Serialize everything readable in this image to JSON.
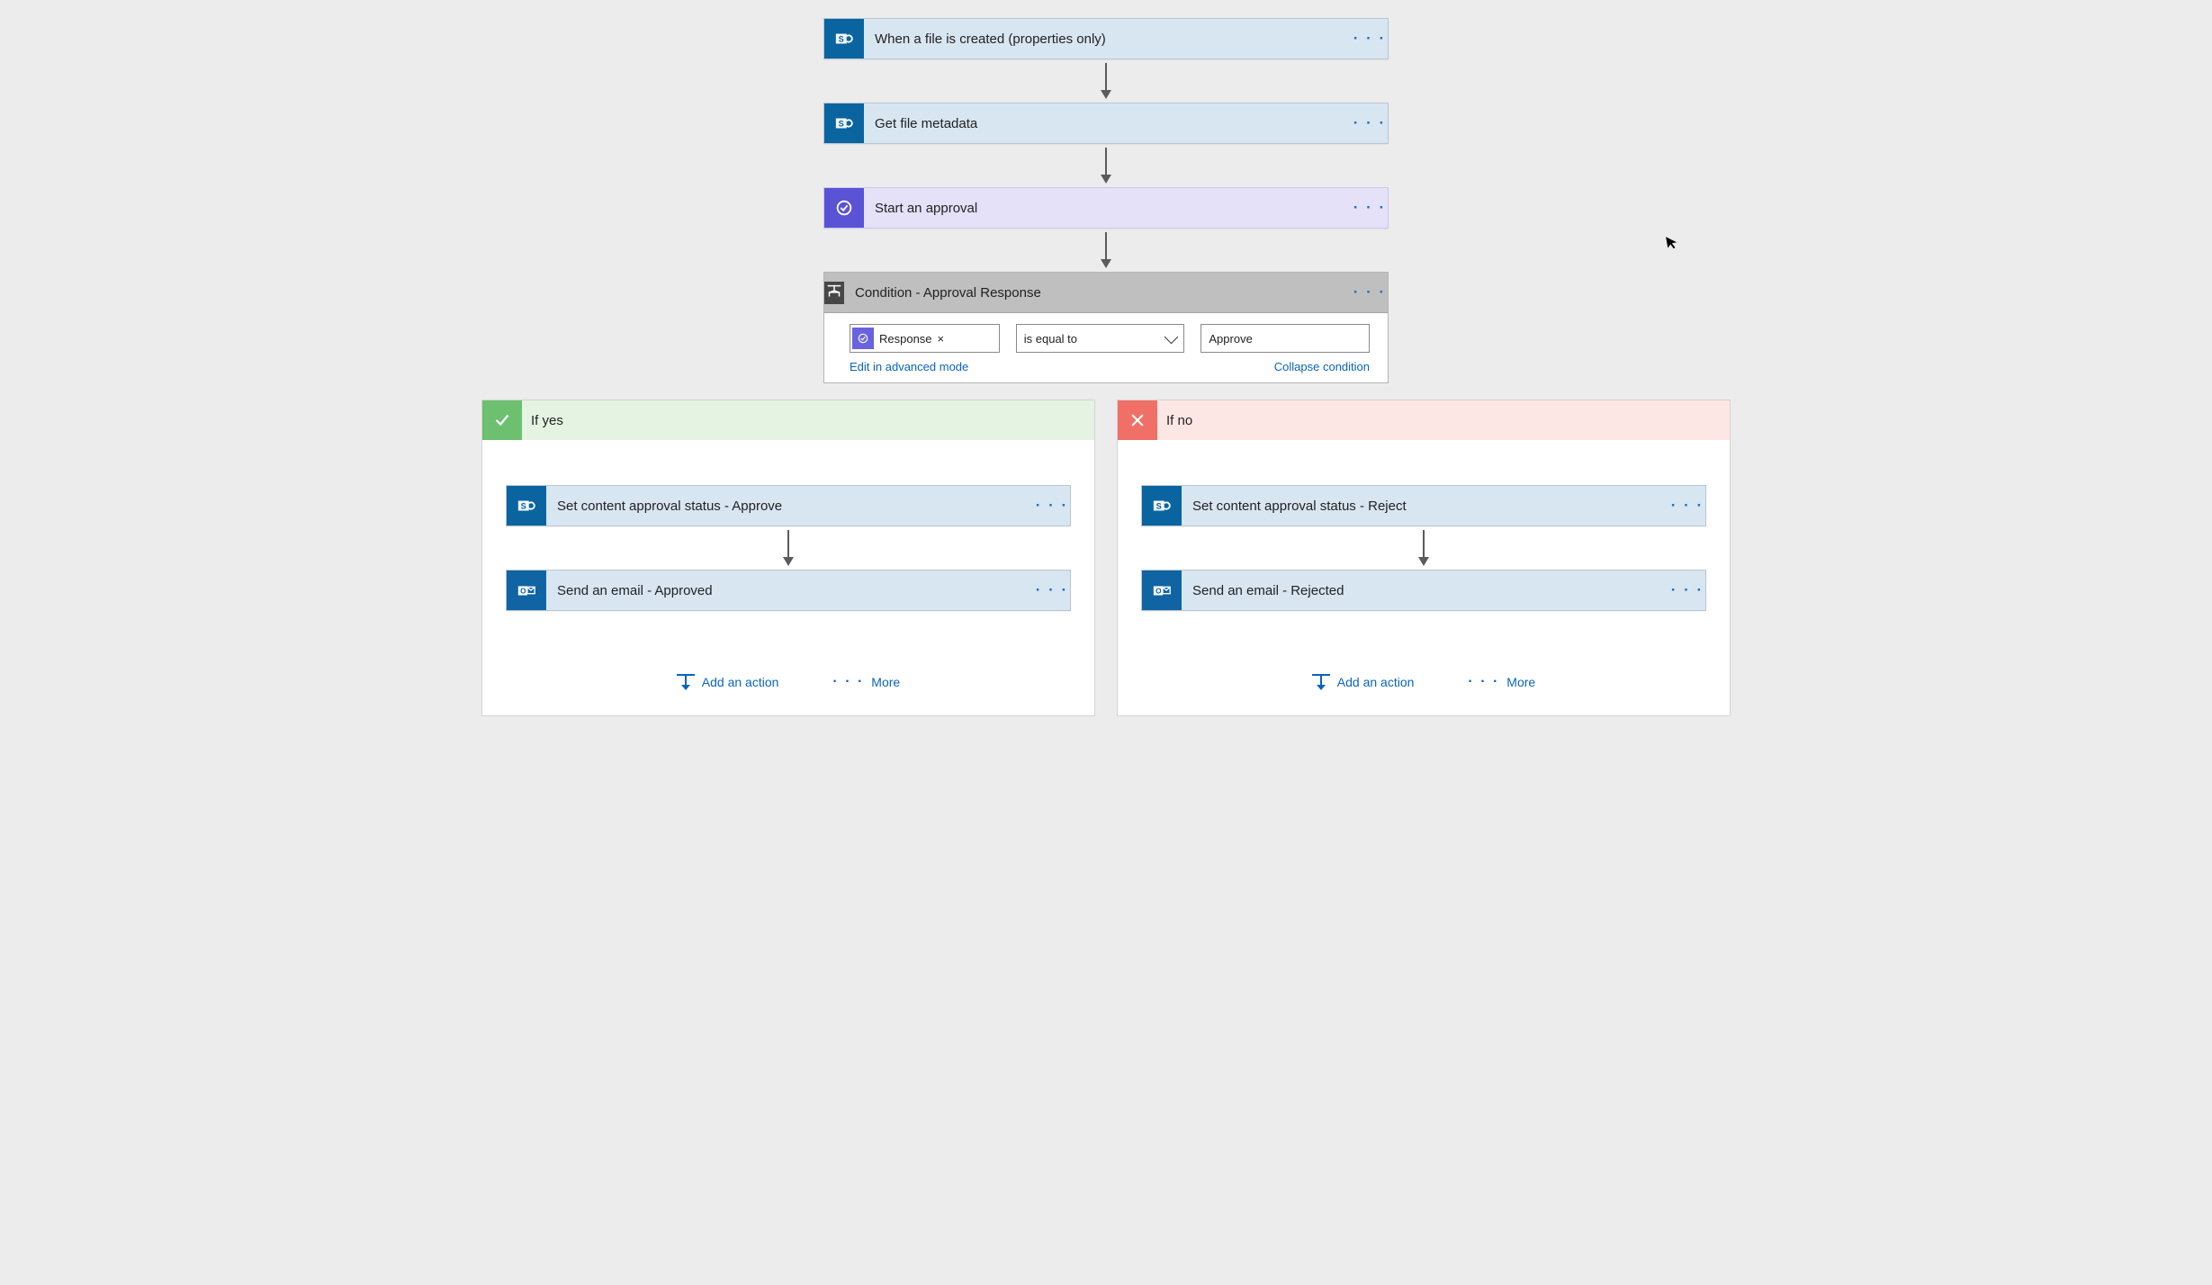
{
  "flow": {
    "steps": [
      {
        "title": "When a file is created (properties only)",
        "icon": "sharepoint"
      },
      {
        "title": "Get file metadata",
        "icon": "sharepoint"
      },
      {
        "title": "Start an approval",
        "icon": "approval"
      }
    ],
    "condition": {
      "title": "Condition - Approval Response",
      "chip_label": "Response",
      "chip_close": "×",
      "operator": "is equal to",
      "value": "Approve",
      "link_advanced": "Edit in advanced mode",
      "link_collapse": "Collapse condition"
    },
    "branches": {
      "yes": {
        "header": "If yes",
        "steps": [
          {
            "title": "Set content approval status - Approve",
            "icon": "sharepoint"
          },
          {
            "title": "Send an email - Approved",
            "icon": "outlook"
          }
        ]
      },
      "no": {
        "header": "If no",
        "steps": [
          {
            "title": "Set content approval status - Reject",
            "icon": "sharepoint"
          },
          {
            "title": "Send an email - Rejected",
            "icon": "outlook"
          }
        ]
      },
      "add_action": "Add an action",
      "more": "More"
    }
  }
}
